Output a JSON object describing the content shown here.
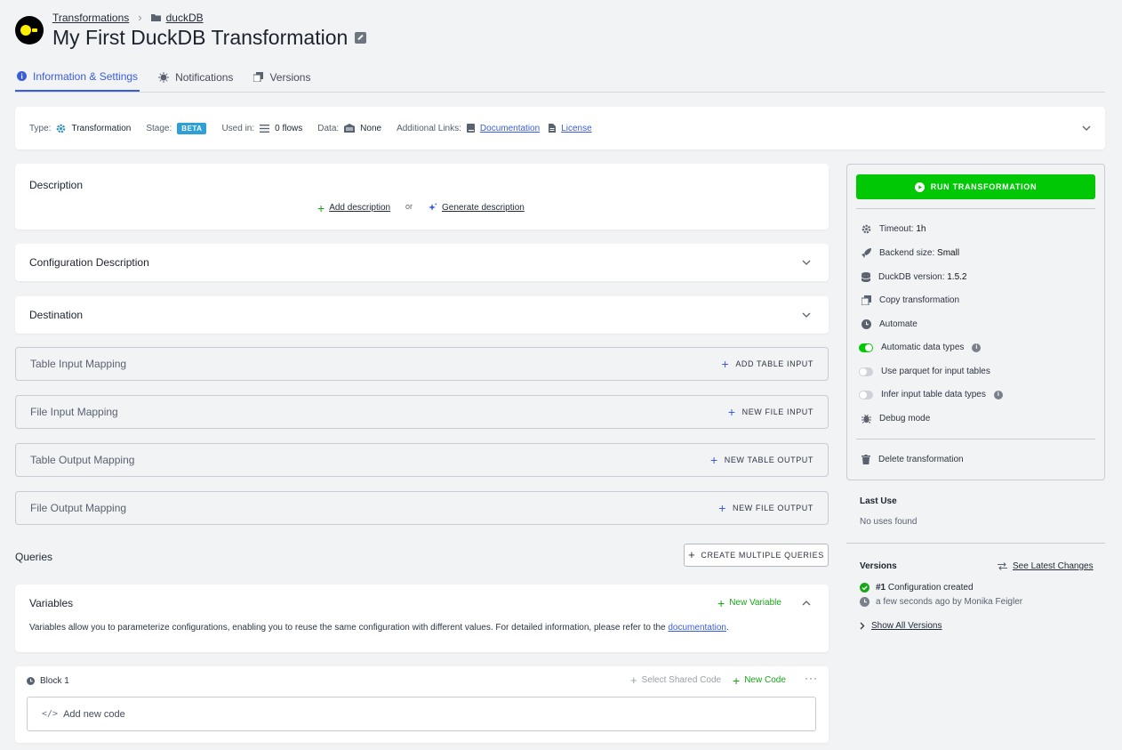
{
  "breadcrumb": {
    "parent": "Transformations",
    "folder": "duckDB"
  },
  "title": "My First DuckDB Transformation",
  "tabs": [
    {
      "label": "Information & Settings",
      "active": true
    },
    {
      "label": "Notifications"
    },
    {
      "label": "Versions"
    }
  ],
  "info": {
    "type_label": "Type:",
    "type_value": "Transformation",
    "stage_label": "Stage:",
    "stage_value": "BETA",
    "used_label": "Used in:",
    "used_value": "0 flows",
    "data_label": "Data:",
    "data_value": "None",
    "links_label": "Additional Links:",
    "doc_link": "Documentation",
    "license_link": "License"
  },
  "description": {
    "title": "Description",
    "add": "Add description",
    "or": "or",
    "generate": "Generate description"
  },
  "config_desc": {
    "title": "Configuration Description"
  },
  "destination": {
    "title": "Destination"
  },
  "mappings": [
    {
      "label": "Table Input Mapping",
      "action": "ADD TABLE INPUT"
    },
    {
      "label": "File Input Mapping",
      "action": "NEW FILE INPUT"
    },
    {
      "label": "Table Output Mapping",
      "action": "NEW TABLE OUTPUT"
    },
    {
      "label": "File Output Mapping",
      "action": "NEW FILE OUTPUT"
    }
  ],
  "queries": {
    "title": "Queries",
    "create_multiple": "CREATE MULTIPLE QUERIES"
  },
  "variables": {
    "title": "Variables",
    "new_variable": "New Variable",
    "text": "Variables allow you to parameterize configurations, enabling you to reuse the same configuration with different values. For detailed information, please refer to the ",
    "link": "documentation",
    "period": "."
  },
  "block": {
    "title": "Block 1",
    "select_shared": "Select Shared Code",
    "new_code": "New Code",
    "add_new_code": "Add new code"
  },
  "sidebar": {
    "run": "RUN TRANSFORMATION",
    "timeout_label": "Timeout:",
    "timeout_value": "1h",
    "backend_label": "Backend size:",
    "backend_value": "Small",
    "duckdb_label": "DuckDB version:",
    "duckdb_value": "1.5.2",
    "copy": "Copy transformation",
    "automate": "Automate",
    "auto_types": "Automatic data types",
    "auto_types_on": true,
    "parquet": "Use parquet for input tables",
    "parquet_on": false,
    "infer": "Infer input table data types",
    "infer_on": false,
    "debug": "Debug mode",
    "delete": "Delete transformation"
  },
  "last_use": {
    "title": "Last Use",
    "value": "No uses found"
  },
  "versions": {
    "title": "Versions",
    "see_latest": "See Latest Changes",
    "entry_num": "#1",
    "entry_text": "Configuration created",
    "entry_meta": "a few seconds ago by Monika Feigler",
    "show_all": "Show All Versions"
  },
  "colors": {
    "accent": "#3b5dd9",
    "run_green": "#00c805",
    "beta": "#2f9fd8"
  }
}
